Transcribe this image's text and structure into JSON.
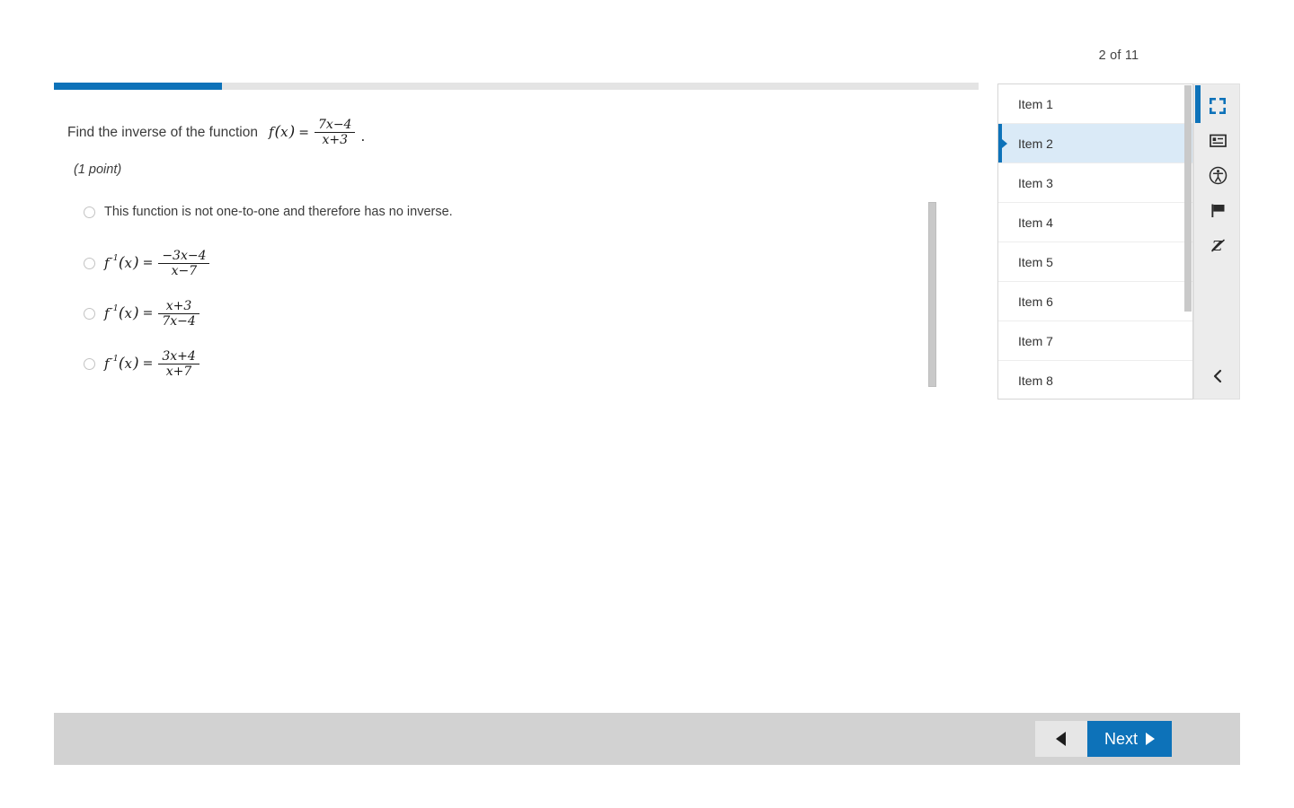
{
  "header": {
    "page_counter": "2 of 11"
  },
  "progress": {
    "percent": 18.2
  },
  "question": {
    "stem_prefix": "Find the inverse of the function",
    "stem_function": {
      "name": "f",
      "arg": "x",
      "equals": "=",
      "numerator": "7x−4",
      "denominator": "x+3",
      "trailing": "."
    },
    "points_label": "(1 point)",
    "options": [
      {
        "type": "text",
        "label": "This function is not one-to-one and therefore has no inverse.",
        "selected": false
      },
      {
        "type": "math",
        "name": "f",
        "sup": "-1",
        "arg": "x",
        "equals": "=",
        "numerator": "−3x−4",
        "denominator": "x−7",
        "selected": false
      },
      {
        "type": "math",
        "name": "f",
        "sup": "-1",
        "arg": "x",
        "equals": "=",
        "numerator": "x+3",
        "denominator": "7x−4",
        "selected": false
      },
      {
        "type": "math",
        "name": "f",
        "sup": "-1",
        "arg": "x",
        "equals": "=",
        "numerator": "3x+4",
        "denominator": "x+7",
        "selected": false
      }
    ]
  },
  "items_panel": {
    "items": [
      {
        "label": "Item 1",
        "selected": false
      },
      {
        "label": "Item 2",
        "selected": true
      },
      {
        "label": "Item 3",
        "selected": false
      },
      {
        "label": "Item 4",
        "selected": false
      },
      {
        "label": "Item 5",
        "selected": false
      },
      {
        "label": "Item 6",
        "selected": false
      },
      {
        "label": "Item 7",
        "selected": false
      },
      {
        "label": "Item 8",
        "selected": false
      }
    ]
  },
  "icon_rail": {
    "icons": [
      {
        "name": "fullscreen-icon",
        "active": true
      },
      {
        "name": "item-list-icon",
        "active": false
      },
      {
        "name": "accessibility-icon",
        "active": false
      },
      {
        "name": "flag-icon",
        "active": false
      },
      {
        "name": "strikethrough-z-icon",
        "active": false
      }
    ],
    "collapse": {
      "name": "collapse-chevron-left-icon"
    }
  },
  "footer": {
    "prev_label": "",
    "next_label": "Next"
  },
  "colors": {
    "accent": "#0d72b9",
    "selected_row": "#daeaf7",
    "footer_bar": "#d2d2d2",
    "rail_bg": "#ececec"
  }
}
